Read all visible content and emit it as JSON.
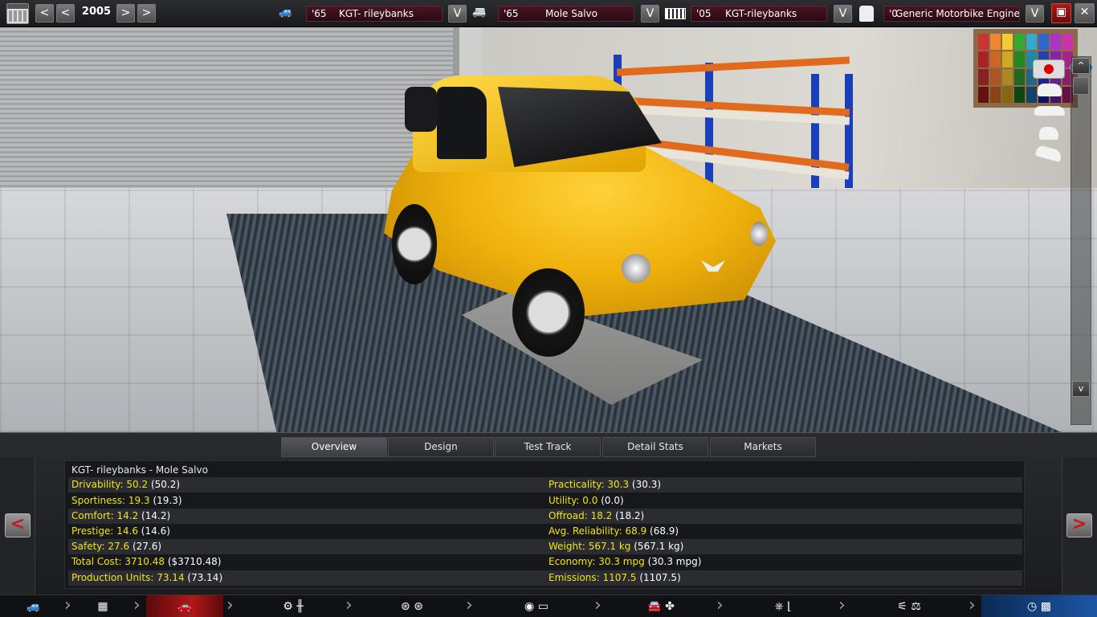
{
  "topbar": {
    "year": "2005",
    "prev_year_label": "<",
    "prev_year_fast_label": "<",
    "next_year_label": ">",
    "next_year_fast_label": ">",
    "car_selector": {
      "year": "'65",
      "name": "KGT- rileybanks"
    },
    "model_selector": {
      "year": "'65",
      "name": "Mole Salvo"
    },
    "chassis_selector": {
      "year": "'05",
      "name": "KGT-rileybanks"
    },
    "engine_selector": {
      "year": "'0",
      "name": "Generic Motorbike Engine"
    },
    "dropdown_label": "V"
  },
  "scene": {
    "scroll_up_label": "^",
    "scroll_down_label": "v"
  },
  "tabs": [
    {
      "label": "Overview",
      "active": true
    },
    {
      "label": "Design",
      "active": false
    },
    {
      "label": "Test Track",
      "active": false
    },
    {
      "label": "Detail Stats",
      "active": false
    },
    {
      "label": "Markets",
      "active": false
    }
  ],
  "panel": {
    "prev_label": "<",
    "next_label": ">",
    "title": "KGT- rileybanks - Mole Salvo",
    "left_stats": [
      {
        "label": "Drivability:",
        "value": "50.2",
        "extra": "(50.2)"
      },
      {
        "label": "Sportiness:",
        "value": "19.3",
        "extra": "(19.3)"
      },
      {
        "label": "Comfort:",
        "value": "14.2",
        "extra": "(14.2)"
      },
      {
        "label": "Prestige:",
        "value": "14.6",
        "extra": "(14.6)"
      },
      {
        "label": "Safety:",
        "value": "27.6",
        "extra": "(27.6)"
      },
      {
        "label": "Total Cost:",
        "value": "3710.48",
        "extra": "($3710.48)"
      },
      {
        "label": "Production Units:",
        "value": "73.14",
        "extra": "(73.14)"
      }
    ],
    "right_stats": [
      {
        "label": "Practicality:",
        "value": "30.3",
        "extra": "(30.3)"
      },
      {
        "label": "Utility:",
        "value": "0.0",
        "extra": "(0.0)"
      },
      {
        "label": "Offroad:",
        "value": "18.2",
        "extra": "(18.2)"
      },
      {
        "label": "Avg. Reliability:",
        "value": "68.9",
        "extra": "(68.9)"
      },
      {
        "label": "Weight:",
        "value": "567.1 kg",
        "extra": "(567.1 kg)"
      },
      {
        "label": "Economy:",
        "value": "30.3 mpg",
        "extra": "(30.3 mpg)"
      },
      {
        "label": "Emissions:",
        "value": "1107.5",
        "extra": "(1107.5)"
      }
    ]
  },
  "navbar": {
    "items": [
      {
        "icon": "car-model-icon",
        "glyph": "🚙"
      },
      {
        "icon": "chassis-icon",
        "glyph": "▦"
      },
      {
        "icon": "car-lift-icon",
        "glyph": "🚗"
      },
      {
        "icon": "gearbox-icon",
        "glyph": "⚙ ╫"
      },
      {
        "icon": "wheels-icon",
        "glyph": "⊛ ⊛"
      },
      {
        "icon": "brakes-icon",
        "glyph": "◉ ▭"
      },
      {
        "icon": "body-aero-icon",
        "glyph": "🚘 ✤"
      },
      {
        "icon": "interior-icon",
        "glyph": "⎈ ⌊"
      },
      {
        "icon": "suspension-icon",
        "glyph": "⚟ ⚖"
      },
      {
        "icon": "test-finish-icon",
        "glyph": "◷ ▩"
      }
    ]
  },
  "colors": {
    "accent_red": "#b01818",
    "stat_yellow": "#f2e416",
    "final_blue": "#1c56a4"
  }
}
